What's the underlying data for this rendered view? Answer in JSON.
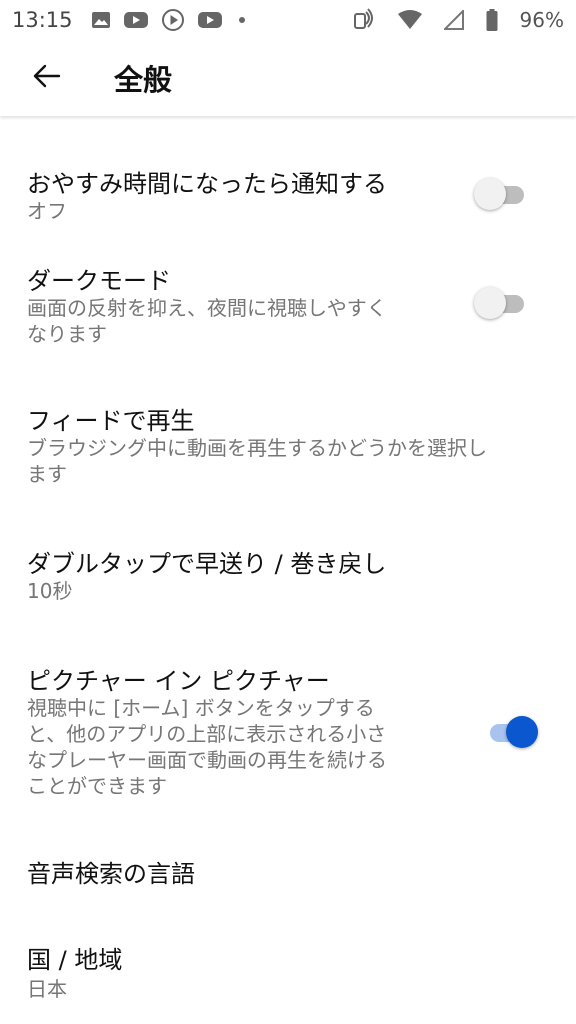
{
  "status_bar": {
    "time": "13:15",
    "battery": "96%",
    "icons": [
      "image-icon",
      "youtube-icon",
      "play-icon",
      "youtube-icon",
      "dot-icon",
      "nfc-icon",
      "wifi-icon",
      "cell-signal-icon",
      "battery-icon"
    ]
  },
  "header": {
    "back_icon": "arrow-left-icon",
    "title": "全般"
  },
  "settings": [
    {
      "title": "おやすみ時間になったら通知する",
      "subtitle": "オフ",
      "toggle": false
    },
    {
      "title": "ダークモード",
      "subtitle": "画面の反射を抑え、夜間に視聴しやすく\nなります",
      "toggle": false
    },
    {
      "title": "フィードで再生",
      "subtitle": "ブラウジング中に動画を再生するかどうかを選択し\nます"
    },
    {
      "title": "ダブルタップで早送り / 巻き戻し",
      "subtitle": "10秒"
    },
    {
      "title": "ピクチャー イン ピクチャー",
      "subtitle": "視聴中に [ホーム] ボタンをタップする\nと、他のアプリの上部に表示される小さ\nなプレーヤー画面で動画の再生を続ける\nことができます",
      "toggle": true
    },
    {
      "title": "音声検索の言語"
    },
    {
      "title": "国 / 地域",
      "subtitle": "日本"
    }
  ],
  "colors": {
    "accent": "#0b57d0",
    "toggle_on_track": "#a8c4ee",
    "toggle_off_track": "#bdbdbd",
    "subtitle": "#767676"
  }
}
